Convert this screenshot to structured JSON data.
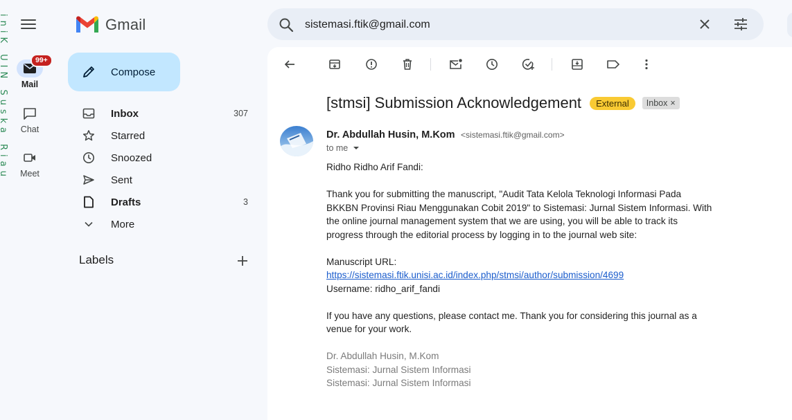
{
  "edge": {
    "text": "iniK UIN Suska Riau"
  },
  "rail": {
    "mail_label": "Mail",
    "mail_badge": "99+",
    "chat_label": "Chat",
    "meet_label": "Meet"
  },
  "app": {
    "logo_text": "Gmail"
  },
  "search": {
    "value": "sistemasi.ftik@gmail.com"
  },
  "compose": {
    "label": "Compose"
  },
  "nav": {
    "items": [
      {
        "label": "Inbox",
        "count": "307"
      },
      {
        "label": "Starred",
        "count": ""
      },
      {
        "label": "Snoozed",
        "count": ""
      },
      {
        "label": "Sent",
        "count": ""
      },
      {
        "label": "Drafts",
        "count": "3"
      },
      {
        "label": "More",
        "count": ""
      }
    ],
    "labels_heading": "Labels"
  },
  "email": {
    "subject": "[stmsi] Submission Acknowledgement",
    "tag_external": "External",
    "tag_inbox": "Inbox",
    "tag_inbox_close": "×",
    "sender_name": "Dr. Abdullah Husin, M.Kom",
    "sender_email": "<sistemasi.ftik@gmail.com>",
    "to": "to me",
    "greeting": "Ridho Ridho Arif Fandi:",
    "paragraph1": "Thank you for submitting the manuscript, \"Audit Tata Kelola Teknologi Informasi Pada BKKBN Provinsi Riau Menggunakan Cobit 2019\" to Sistemasi: Jurnal Sistem Informasi. With the online journal management system that we are using, you will be able to track its progress through the editorial process by logging in to the journal web site:",
    "manuscript_url_label": "Manuscript URL:",
    "manuscript_url": "https://sistemasi.ftik.unisi.ac.id/index.php/stmsi/author/submission/4699",
    "username": "Username: ridho_arif_fandi",
    "paragraph2": "If you have any questions, please contact me. Thank you for considering this journal as a venue for your work.",
    "signature": [
      "Dr. Abdullah Husin, M.Kom",
      "Sistemasi: Jurnal Sistem Informasi",
      "Sistemasi: Jurnal Sistem Informasi"
    ]
  },
  "colors": {
    "compose_bg": "#c2e7ff",
    "external_tag": "#f9ca33",
    "link": "#1a5ccc",
    "badge": "#c5221f"
  }
}
